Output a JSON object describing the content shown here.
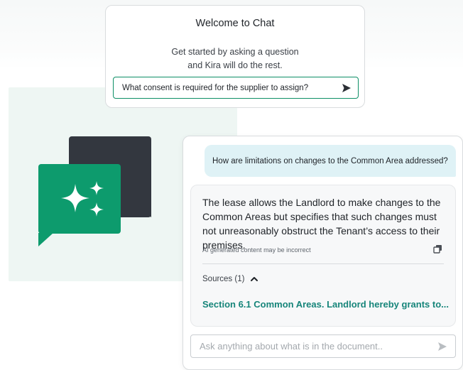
{
  "welcome": {
    "title": "Welcome to Chat",
    "subtitle_line1": "Get started by asking a question",
    "subtitle_line2": "and Kira will do the rest.",
    "question": "What consent is required for the supplier to assign?",
    "send_icon": "send-arrow-icon"
  },
  "chat": {
    "user_message": "How are limitations on changes to the Common Area addressed?",
    "ai_answer": "The lease allows the Landlord to make changes to the Common Areas but specifies that such changes must not unreasonably obstruct the Tenant’s access to their premises.",
    "disclaimer": "AI generated content may be incorrect",
    "copy_icon": "copy-icon",
    "sources_label": "Sources (1)",
    "sources_toggle_icon": "chevron-up-icon",
    "source_item": "Section 6.1 Common Areas. Landlord hereby grants to...",
    "input_placeholder": "Ask anything about what is in the document..",
    "send_icon": "send-arrow-icon"
  },
  "colors": {
    "brand_green": "#0d9b6d",
    "dark_bubble": "#33373f",
    "user_bubble": "#dff2f6",
    "source_link": "#16857a",
    "mint_panel": "#eef6f3"
  }
}
